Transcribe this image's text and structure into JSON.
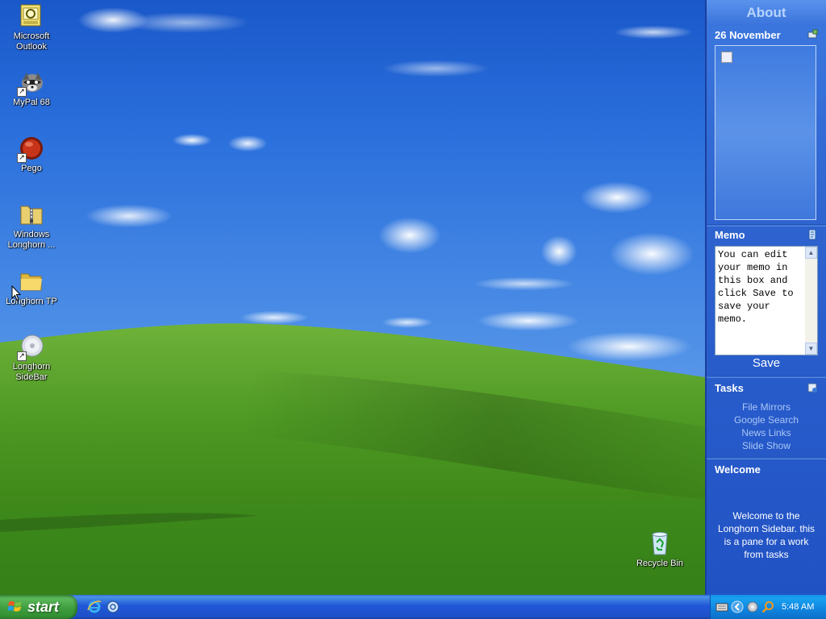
{
  "desktop": {
    "icons": [
      {
        "label": "Microsoft\nOutlook",
        "icon": "outlook-icon"
      },
      {
        "label": "MyPal 68",
        "icon": "raccoon-icon"
      },
      {
        "label": "Pego",
        "icon": "red-orb-icon"
      },
      {
        "label": "Windows\nLonghorn ...",
        "icon": "zip-folder-icon"
      },
      {
        "label": "Longhorn TP",
        "icon": "folder-icon"
      },
      {
        "label": "Longhorn\nSideBar",
        "icon": "sidebar-disc-icon"
      },
      {
        "label": "Recycle Bin",
        "icon": "recycle-bin-icon"
      }
    ]
  },
  "sidebar": {
    "title": "About",
    "date": "26 November",
    "memo": {
      "header": "Memo",
      "text": "You can edit your memo in this box and click Save to save your memo.",
      "save_label": "Save"
    },
    "tasks": {
      "header": "Tasks",
      "items": [
        "File Mirrors",
        "Google Search",
        "News Links",
        "Slide Show"
      ]
    },
    "welcome": {
      "header": "Welcome",
      "text": "Welcome to the Longhorn Sidebar. this is a pane for a work from tasks"
    },
    "colors": {
      "task_link": "#a9c7f5",
      "title": "#b8d4ff"
    }
  },
  "taskbar": {
    "start_label": "start",
    "quick_launch": [
      "internet-explorer-icon",
      "browser-icon"
    ],
    "tray_icons": [
      "keyboard-icon",
      "chevron-left-icon",
      "network-icon",
      "search-icon"
    ],
    "clock": "5:48 AM"
  }
}
